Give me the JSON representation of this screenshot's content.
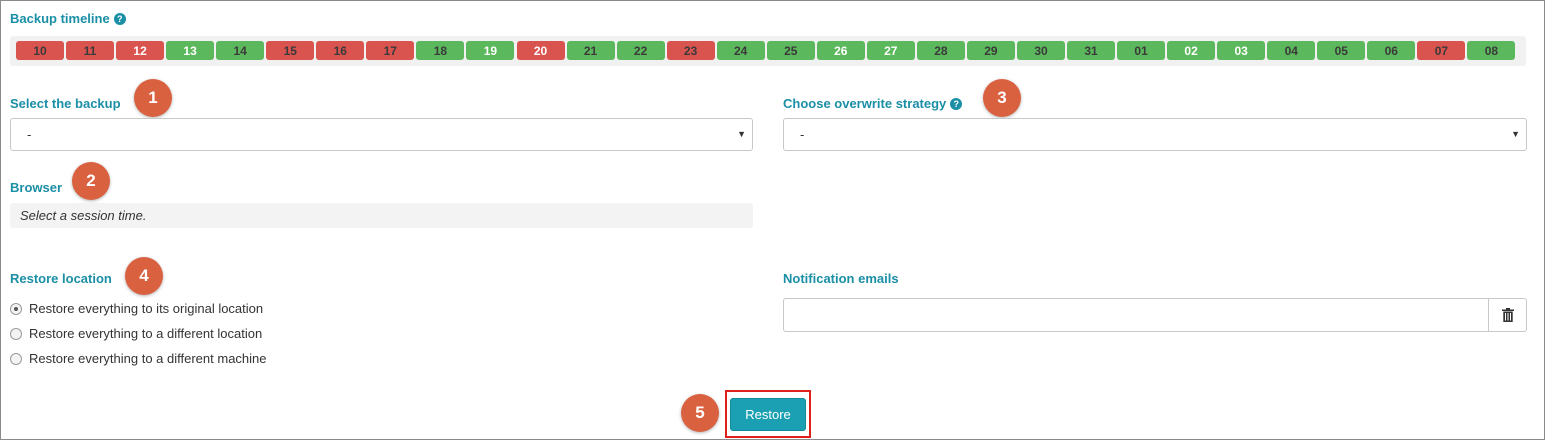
{
  "timeline": {
    "label": "Backup timeline",
    "help_icon": "question-circle-icon",
    "colors": {
      "success": "#5cb85c",
      "failed": "#d9534f"
    },
    "days": [
      {
        "label": "10",
        "status": "failed"
      },
      {
        "label": "11",
        "status": "failed"
      },
      {
        "label": "12",
        "status": "failed",
        "highlight": true
      },
      {
        "label": "13",
        "status": "success",
        "highlight": true
      },
      {
        "label": "14",
        "status": "success"
      },
      {
        "label": "15",
        "status": "failed"
      },
      {
        "label": "16",
        "status": "failed"
      },
      {
        "label": "17",
        "status": "failed"
      },
      {
        "label": "18",
        "status": "success"
      },
      {
        "label": "19",
        "status": "success",
        "highlight": true
      },
      {
        "label": "20",
        "status": "failed",
        "highlight": true
      },
      {
        "label": "21",
        "status": "success"
      },
      {
        "label": "22",
        "status": "success"
      },
      {
        "label": "23",
        "status": "failed"
      },
      {
        "label": "24",
        "status": "success"
      },
      {
        "label": "25",
        "status": "success"
      },
      {
        "label": "26",
        "status": "success",
        "highlight": true
      },
      {
        "label": "27",
        "status": "success",
        "highlight": true
      },
      {
        "label": "28",
        "status": "success"
      },
      {
        "label": "29",
        "status": "success"
      },
      {
        "label": "30",
        "status": "success"
      },
      {
        "label": "31",
        "status": "success"
      },
      {
        "label": "01",
        "status": "success"
      },
      {
        "label": "02",
        "status": "success",
        "highlight": true
      },
      {
        "label": "03",
        "status": "success",
        "highlight": true
      },
      {
        "label": "04",
        "status": "success"
      },
      {
        "label": "05",
        "status": "success"
      },
      {
        "label": "06",
        "status": "success"
      },
      {
        "label": "07",
        "status": "failed"
      },
      {
        "label": "08",
        "status": "success"
      }
    ]
  },
  "backup_select": {
    "label": "Select the backup",
    "value": "-",
    "badge": "1"
  },
  "browser": {
    "label": "Browser",
    "placeholder_text": "Select a session time.",
    "badge": "2"
  },
  "overwrite": {
    "label": "Choose overwrite strategy",
    "help_icon": "question-circle-icon",
    "value": "-",
    "badge": "3"
  },
  "restore_location": {
    "label": "Restore location",
    "badge": "4",
    "options": [
      {
        "label": "Restore everything to its original location",
        "checked": true
      },
      {
        "label": "Restore everything to a different location",
        "checked": false
      },
      {
        "label": "Restore everything to a different machine",
        "checked": false
      }
    ]
  },
  "notification": {
    "label": "Notification emails",
    "value": "",
    "delete_icon": "trash-icon"
  },
  "restore": {
    "label": "Restore",
    "badge": "5",
    "color": "#1aa0b2",
    "highlight_color": "#e0201b"
  },
  "badge_color": "#d9613f"
}
